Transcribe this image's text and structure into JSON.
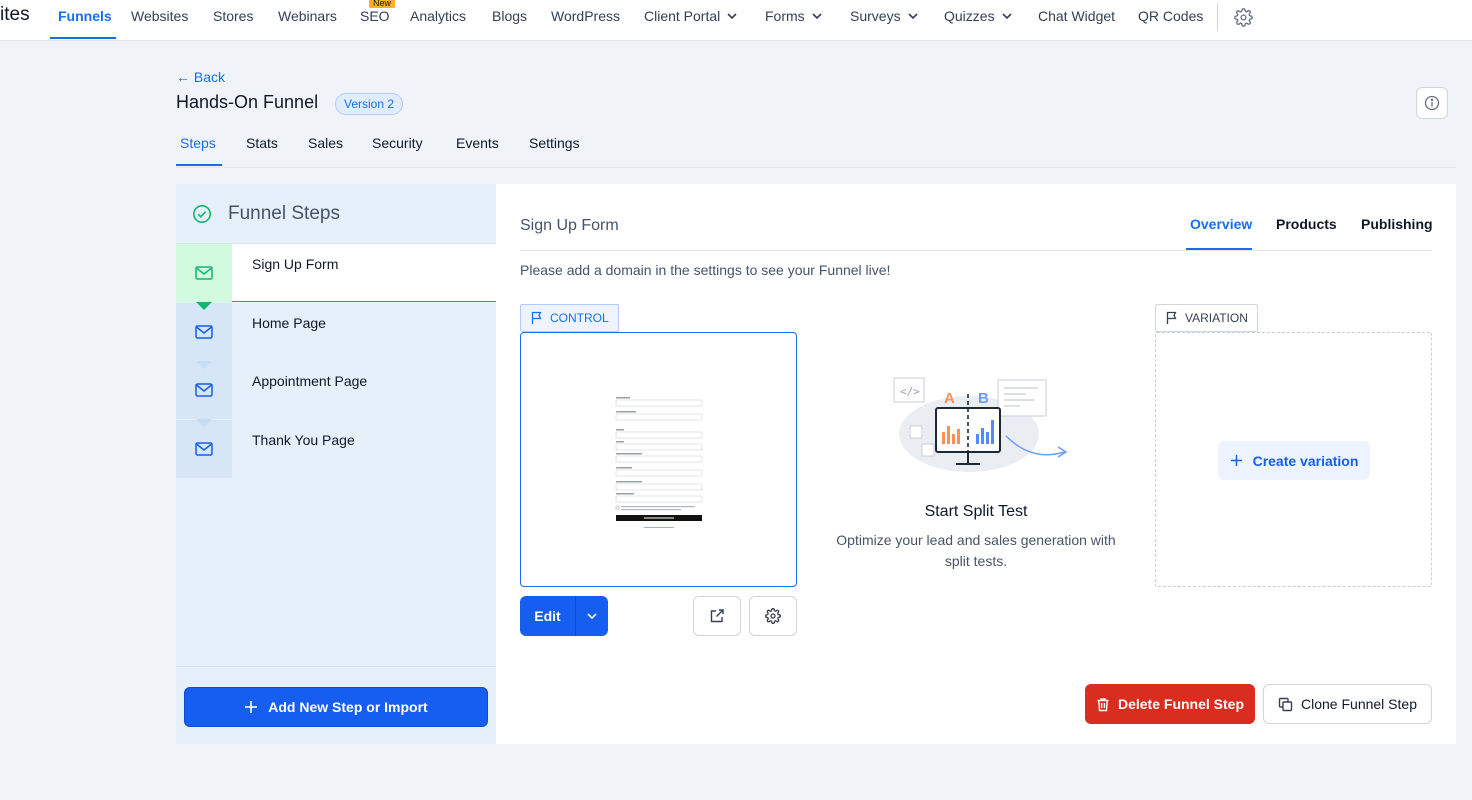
{
  "topnav": {
    "cut_label": "ites",
    "items": [
      {
        "label": "Funnels",
        "active": true
      },
      {
        "label": "Websites"
      },
      {
        "label": "Stores"
      },
      {
        "label": "Webinars"
      },
      {
        "label": "SEO",
        "badge": "New"
      },
      {
        "label": "Analytics"
      },
      {
        "label": "Blogs"
      },
      {
        "label": "WordPress"
      },
      {
        "label": "Client Portal",
        "dropdown": true
      },
      {
        "label": "Forms",
        "dropdown": true
      },
      {
        "label": "Surveys",
        "dropdown": true
      },
      {
        "label": "Quizzes",
        "dropdown": true
      },
      {
        "label": "Chat Widget"
      },
      {
        "label": "QR Codes"
      }
    ],
    "settings_icon": "gear-icon"
  },
  "header": {
    "back_label": "← Back",
    "title": "Hands-On Funnel",
    "version_badge": "Version 2",
    "info_icon": "info-icon"
  },
  "tabs": [
    {
      "label": "Steps",
      "active": true
    },
    {
      "label": "Stats"
    },
    {
      "label": "Sales"
    },
    {
      "label": "Security"
    },
    {
      "label": "Events"
    },
    {
      "label": "Settings"
    }
  ],
  "funnel_steps": {
    "title": "Funnel Steps",
    "steps": [
      {
        "label": "Sign Up Form",
        "active": true,
        "icon": "mail-icon"
      },
      {
        "label": "Home Page",
        "icon": "mail-icon"
      },
      {
        "label": "Appointment Page",
        "icon": "mail-icon"
      },
      {
        "label": "Thank You Page",
        "icon": "mail-icon"
      }
    ],
    "add_button": "Add New Step or Import"
  },
  "step_detail": {
    "title": "Sign Up Form",
    "tabs": [
      {
        "label": "Overview",
        "active": true
      },
      {
        "label": "Products"
      },
      {
        "label": "Publishing"
      }
    ],
    "domain_note": "Please add a domain in the settings to see your Funnel live!",
    "control_label": "CONTROL",
    "edit_label": "Edit",
    "variation_label": "VARIATION",
    "create_variation": "Create variation",
    "split_test": {
      "title": "Start Split Test",
      "description": "Optimize your lead and sales generation with split tests.",
      "letter_a": "A",
      "letter_b": "B"
    },
    "delete_button": "Delete Funnel Step",
    "clone_button": "Clone Funnel Step"
  },
  "colors": {
    "primary": "#155eef",
    "link": "#1570ef",
    "danger": "#d92d20",
    "success": "#12b76a",
    "panel_bg": "#e5f0fb"
  }
}
